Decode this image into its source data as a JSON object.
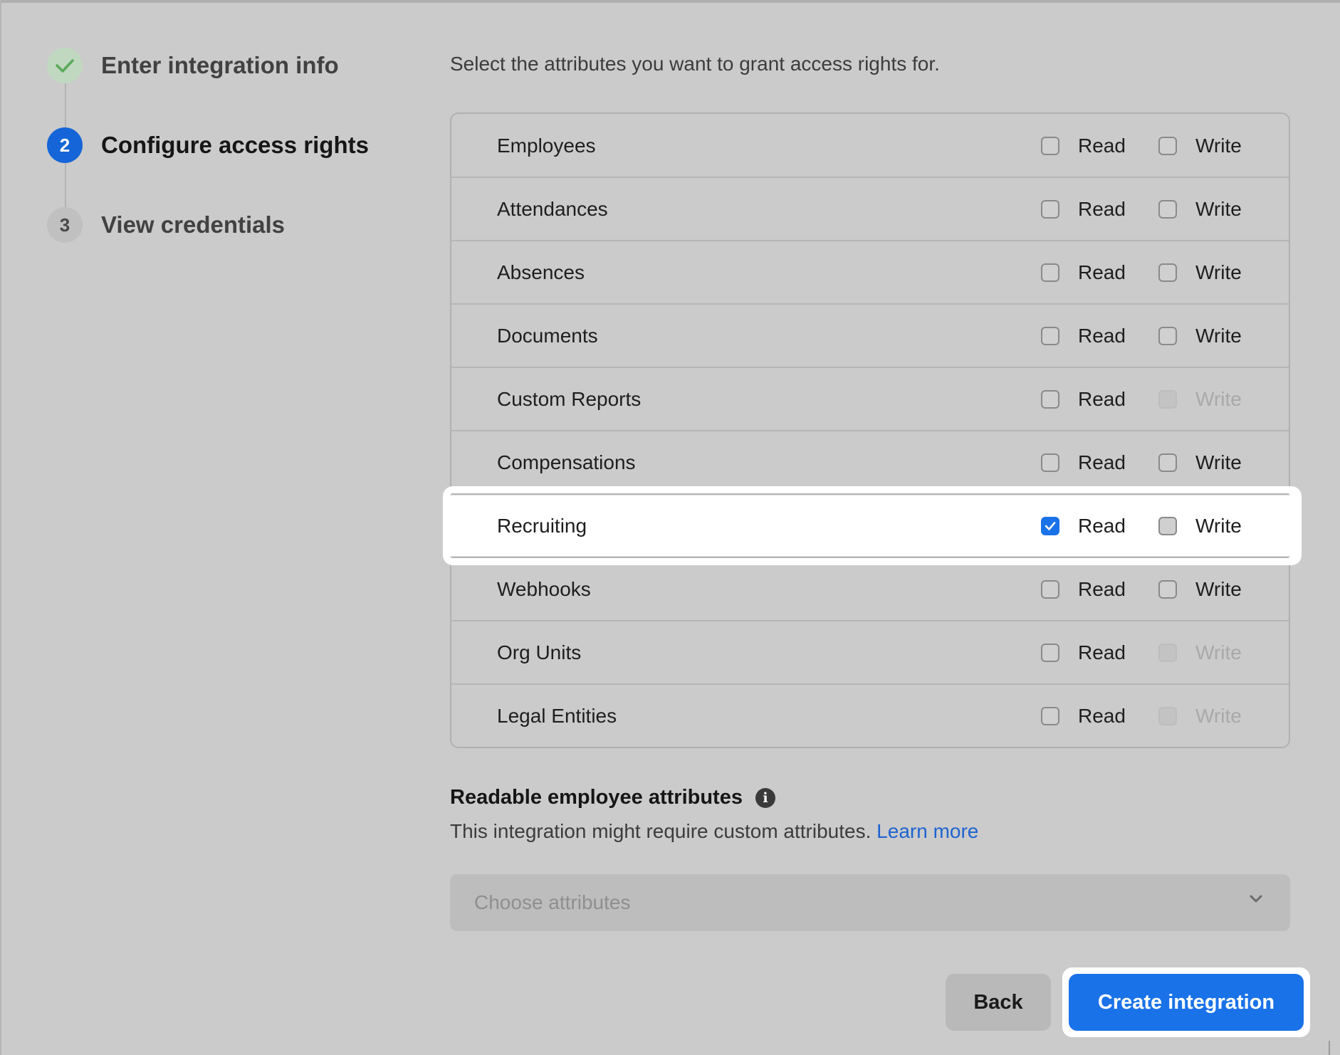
{
  "stepper": {
    "steps": [
      {
        "number": "",
        "label": "Enter integration info",
        "state": "done",
        "icon": "check-icon"
      },
      {
        "number": "2",
        "label": "Configure access rights",
        "state": "active"
      },
      {
        "number": "3",
        "label": "View credentials",
        "state": "pending"
      }
    ]
  },
  "intro": "Select the attributes you want to grant access rights for.",
  "permissions": {
    "read_label": "Read",
    "write_label": "Write",
    "rows": [
      {
        "name": "Employees",
        "read": false,
        "write": false,
        "write_disabled": false
      },
      {
        "name": "Attendances",
        "read": false,
        "write": false,
        "write_disabled": false
      },
      {
        "name": "Absences",
        "read": false,
        "write": false,
        "write_disabled": false
      },
      {
        "name": "Documents",
        "read": false,
        "write": false,
        "write_disabled": false
      },
      {
        "name": "Custom Reports",
        "read": false,
        "write": false,
        "write_disabled": true
      },
      {
        "name": "Compensations",
        "read": false,
        "write": false,
        "write_disabled": false
      },
      {
        "name": "Recruiting",
        "read": true,
        "write": false,
        "write_disabled": false
      },
      {
        "name": "Webhooks",
        "read": false,
        "write": false,
        "write_disabled": false
      },
      {
        "name": "Org Units",
        "read": false,
        "write": false,
        "write_disabled": true
      },
      {
        "name": "Legal Entities",
        "read": false,
        "write": false,
        "write_disabled": true
      }
    ]
  },
  "readable": {
    "title": "Readable employee attributes",
    "info_icon": "i",
    "description": "This integration might require custom attributes.",
    "learn_more": "Learn more",
    "select_placeholder": "Choose attributes"
  },
  "footer": {
    "back_label": "Back",
    "create_label": "Create integration"
  },
  "colors": {
    "accent": "#1a72e8",
    "step_active": "#1565d8",
    "link": "#1d64d0",
    "done": "#5aaa5a"
  }
}
